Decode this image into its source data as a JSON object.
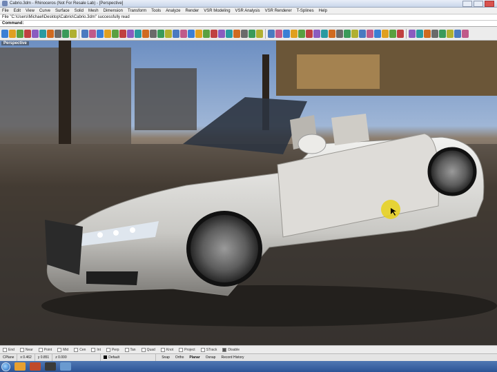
{
  "window": {
    "title": "Cabrio.3dm - Rhinoceros (Not For Resale Lab) - [Perspective]"
  },
  "menu": [
    "File",
    "Edit",
    "View",
    "Curve",
    "Surface",
    "Solid",
    "Mesh",
    "Dimension",
    "Transform",
    "Tools",
    "Analyze",
    "Render",
    "VSR Modeling",
    "VSR Analysis",
    "VSR Renderer",
    "T-Splines",
    "Help"
  ],
  "command": {
    "history": "File \"C:\\Users\\Michael\\Desktop\\Cabrio\\Cabrio.3dm\" successfully read",
    "label": "Command:",
    "value": ""
  },
  "viewport": {
    "label": "Perspective"
  },
  "toolbar_colors": [
    "#3b7fd4",
    "#e0a020",
    "#5aa040",
    "#c04040",
    "#8a5cc0",
    "#2a9aa0",
    "#d06a20",
    "#6a6a6a",
    "#3a9a5a",
    "#b0b030",
    "#4a7ac0",
    "#c05a8a"
  ],
  "osnaps": [
    {
      "label": "End",
      "on": false
    },
    {
      "label": "Near",
      "on": false
    },
    {
      "label": "Point",
      "on": false
    },
    {
      "label": "Mid",
      "on": false
    },
    {
      "label": "Cen",
      "on": false
    },
    {
      "label": "Int",
      "on": false
    },
    {
      "label": "Perp",
      "on": false
    },
    {
      "label": "Tan",
      "on": false
    },
    {
      "label": "Quad",
      "on": false
    },
    {
      "label": "Knot",
      "on": false
    },
    {
      "label": "Project",
      "on": false
    },
    {
      "label": "STrack",
      "on": false
    },
    {
      "label": "Disable",
      "on": true
    }
  ],
  "status": {
    "cplane": "CPlane",
    "x": "x 0.462",
    "y": "y 0.851",
    "z": "z 0.000",
    "layer": "Default",
    "toggles": [
      {
        "label": "Snap",
        "active": false
      },
      {
        "label": "Ortho",
        "active": false
      },
      {
        "label": "Planar",
        "active": true
      },
      {
        "label": "Osnap",
        "active": false
      },
      {
        "label": "Record History",
        "active": false
      }
    ]
  },
  "taskbar_colors": [
    "#e8a030",
    "#c04a2a",
    "#3a3a3a",
    "#6a9ad0"
  ]
}
